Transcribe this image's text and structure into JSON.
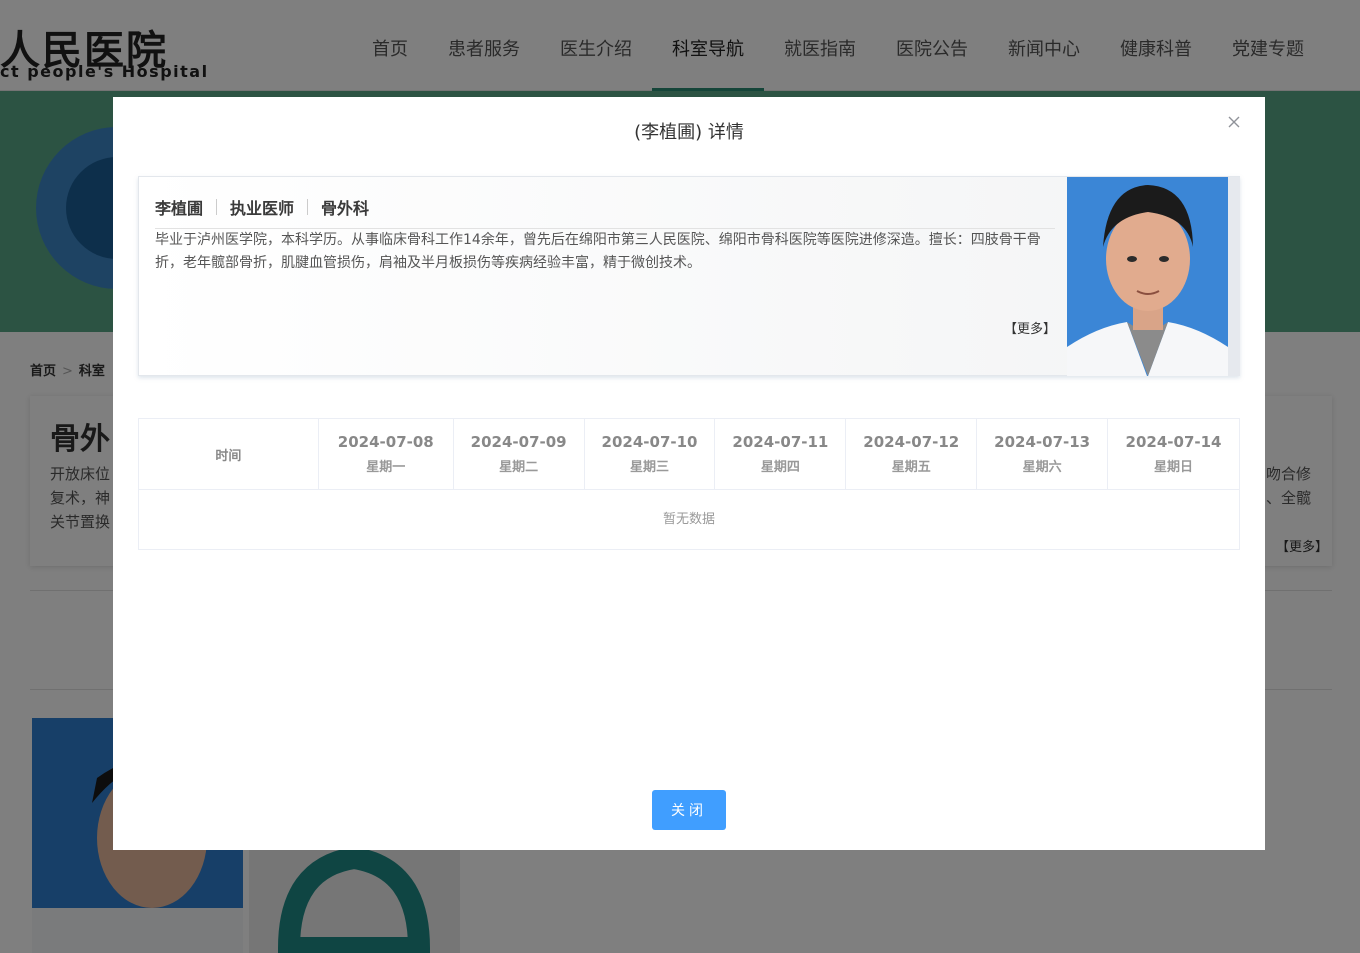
{
  "header": {
    "logo_cn": "人民医院",
    "logo_en": "ct people's Hospital",
    "nav": [
      {
        "label": "首页"
      },
      {
        "label": "患者服务"
      },
      {
        "label": "医生介绍"
      },
      {
        "label": "科室导航"
      },
      {
        "label": "就医指南"
      },
      {
        "label": "医院公告"
      },
      {
        "label": "新闻中心"
      },
      {
        "label": "健康科普"
      },
      {
        "label": "党建专题"
      }
    ],
    "active_nav": "科室导航"
  },
  "breadcrumb": {
    "home": "首页",
    "current": "科室"
  },
  "department": {
    "title": "骨外",
    "text_left": "开放床位<br>复术，神<br>关节置换",
    "text_right_1": "吻合修",
    "text_right_2": "、全髋",
    "more": "【更多】"
  },
  "modal": {
    "title": "(李植圃) 详情",
    "doctor": {
      "name": "李植圃",
      "title": "执业医师",
      "department": "骨外科",
      "description": "毕业于泸州医学院，本科学历。从事临床骨科工作14余年，曾先后在绵阳市第三人民医院、绵阳市骨科医院等医院进修深造。擅长：四肢骨干骨折，老年髋部骨折，肌腱血管损伤，肩袖及半月板损伤等疾病经验丰富，精于微创技术。",
      "more": "【更多】"
    },
    "schedule": {
      "time_header": "时间",
      "days": [
        {
          "date": "2024-07-08",
          "weekday": "星期一"
        },
        {
          "date": "2024-07-09",
          "weekday": "星期二"
        },
        {
          "date": "2024-07-10",
          "weekday": "星期三"
        },
        {
          "date": "2024-07-11",
          "weekday": "星期四"
        },
        {
          "date": "2024-07-12",
          "weekday": "星期五"
        },
        {
          "date": "2024-07-13",
          "weekday": "星期六"
        },
        {
          "date": "2024-07-14",
          "weekday": "星期日"
        }
      ],
      "empty_text": "暂无数据"
    },
    "close_button": "关闭"
  },
  "colors": {
    "accent": "#409eff",
    "banner": "#58a787",
    "nav_active_underline": "#2b8a73",
    "overlay": "rgba(0,0,0,0.5)"
  }
}
